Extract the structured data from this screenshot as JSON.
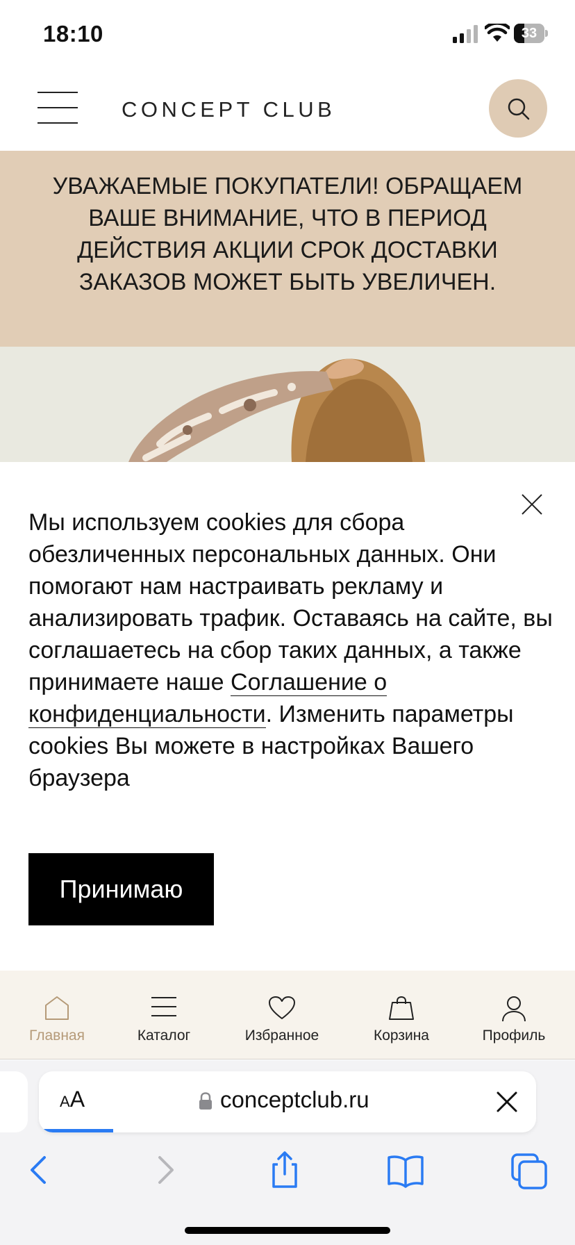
{
  "status_bar": {
    "time": "18:10",
    "battery_level": "33",
    "signal_icon": "cellular-signal-icon",
    "wifi_icon": "wifi-icon"
  },
  "header": {
    "logo": "CONCEPT CLUB",
    "menu_icon": "hamburger-menu-icon",
    "search_icon": "search-icon",
    "search_button_color": "#dfcbb4"
  },
  "notice": {
    "text": "УВАЖАЕМЫЕ ПОКУПАТЕЛИ! ОБРАЩАЕМ ВАШЕ ВНИМАНИЕ, ЧТО В ПЕРИОД ДЕЙСТВИЯ АКЦИИ СРОК ДОСТАВКИ ЗАКАЗОВ МОЖЕТ БЫТЬ УВЕЛИЧЕН.",
    "background": "#e1cdb6"
  },
  "cookie_banner": {
    "text_before_link": "Мы используем cookies для сбора обезличенных персональных данных. Они помогают нам настраивать рекламу и анализировать трафик. Оставаясь на сайте, вы соглашаетесь на сбор таких данных, а также принимаете наше ",
    "link_text": "Соглашение о конфиденциальности",
    "text_after_link": ". Изменить параметры cookies Вы можете в настройках Вашего браузера",
    "accept_label": "Принимаю",
    "close_icon": "close-icon"
  },
  "bottom_nav": {
    "items": [
      {
        "label": "Главная",
        "icon": "home-icon",
        "active": true
      },
      {
        "label": "Каталог",
        "icon": "catalog-icon",
        "active": false
      },
      {
        "label": "Избранное",
        "icon": "heart-icon",
        "active": false
      },
      {
        "label": "Корзина",
        "icon": "bag-icon",
        "active": false
      },
      {
        "label": "Профиль",
        "icon": "profile-icon",
        "active": false
      }
    ],
    "active_color": "#b59a78"
  },
  "browser": {
    "text_size_button": "AA",
    "url": "conceptclub.ru",
    "lock_icon": "lock-icon",
    "load_progress": 0.15,
    "toolbar": [
      "back-icon",
      "forward-icon",
      "share-icon",
      "bookmarks-icon",
      "tabs-icon"
    ],
    "accent": "#2a7bf3"
  }
}
